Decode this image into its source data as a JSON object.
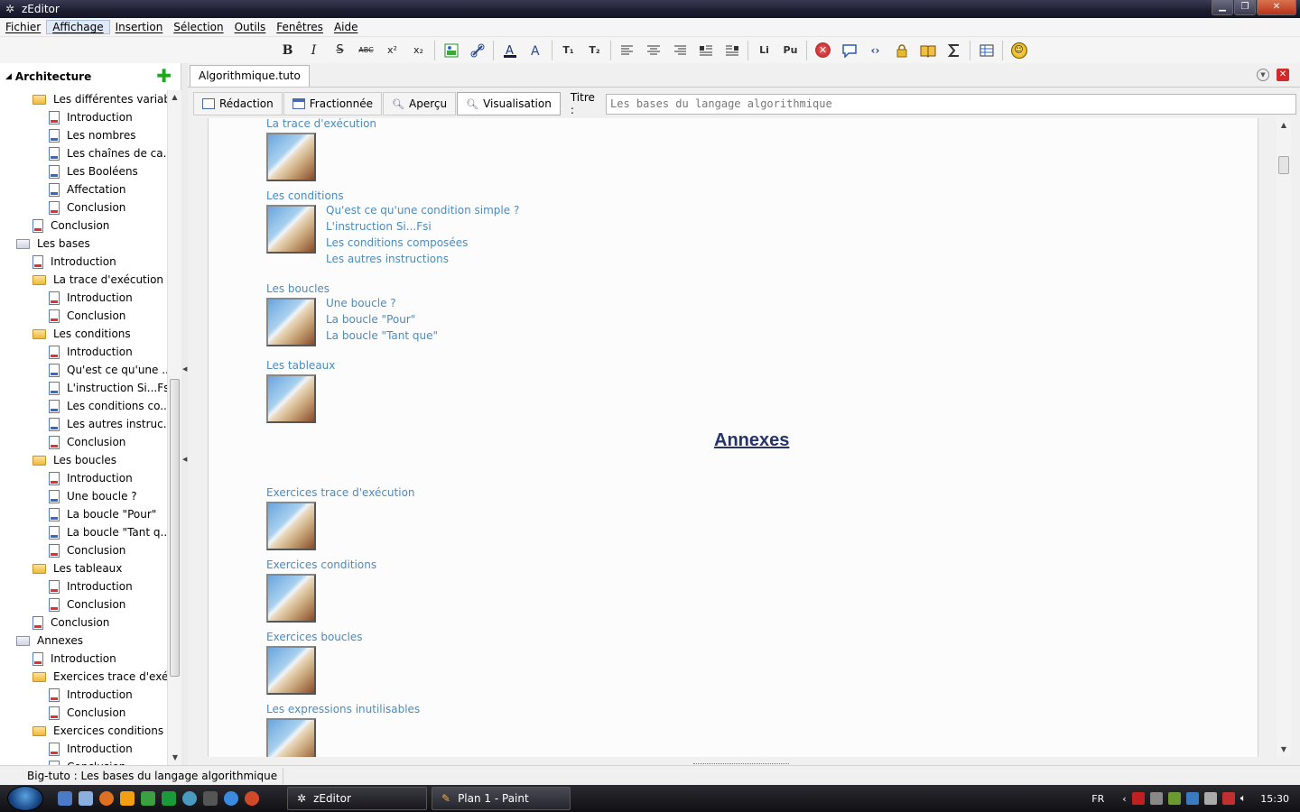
{
  "window": {
    "title": "zEditor"
  },
  "menu": [
    "Fichier",
    "Affichage",
    "Insertion",
    "Sélection",
    "Outils",
    "Fenêtres",
    "Aide"
  ],
  "toolbar": {
    "bold": "B",
    "italic": "I",
    "strike": "S",
    "caps": "ABC",
    "sup": "x²",
    "sub": "x₂",
    "li": "Li",
    "pu": "Pu",
    "t1": "T₁",
    "t2": "T₂"
  },
  "sidebar": {
    "header": "Architecture",
    "items": [
      {
        "label": "Les différentes variab...",
        "icon": "folder",
        "level": 1
      },
      {
        "label": "Introduction",
        "icon": "doc-red",
        "level": 2
      },
      {
        "label": "Les nombres",
        "icon": "doc",
        "level": 2
      },
      {
        "label": "Les chaînes de ca...",
        "icon": "doc",
        "level": 2
      },
      {
        "label": "Les Booléens",
        "icon": "doc",
        "level": 2
      },
      {
        "label": "Affectation",
        "icon": "doc",
        "level": 2
      },
      {
        "label": "Conclusion",
        "icon": "doc-red",
        "level": 2
      },
      {
        "label": "Conclusion",
        "icon": "doc-red",
        "level": 1
      },
      {
        "label": "Les bases",
        "icon": "folder-root",
        "level": 0
      },
      {
        "label": "Introduction",
        "icon": "doc-red",
        "level": 1
      },
      {
        "label": "La trace d'exécution",
        "icon": "folder",
        "level": 1
      },
      {
        "label": "Introduction",
        "icon": "doc-red",
        "level": 2
      },
      {
        "label": "Conclusion",
        "icon": "doc-red",
        "level": 2
      },
      {
        "label": "Les conditions",
        "icon": "folder",
        "level": 1
      },
      {
        "label": "Introduction",
        "icon": "doc-red",
        "level": 2
      },
      {
        "label": "Qu'est ce qu'une ...",
        "icon": "doc",
        "level": 2
      },
      {
        "label": "L'instruction Si...Fsi",
        "icon": "doc",
        "level": 2
      },
      {
        "label": "Les conditions co...",
        "icon": "doc",
        "level": 2
      },
      {
        "label": "Les autres instruc...",
        "icon": "doc",
        "level": 2
      },
      {
        "label": "Conclusion",
        "icon": "doc-red",
        "level": 2
      },
      {
        "label": "Les boucles",
        "icon": "folder",
        "level": 1
      },
      {
        "label": "Introduction",
        "icon": "doc-red",
        "level": 2
      },
      {
        "label": "Une boucle ?",
        "icon": "doc",
        "level": 2
      },
      {
        "label": "La boucle \"Pour\"",
        "icon": "doc",
        "level": 2
      },
      {
        "label": "La boucle \"Tant q...",
        "icon": "doc",
        "level": 2
      },
      {
        "label": "Conclusion",
        "icon": "doc-red",
        "level": 2
      },
      {
        "label": "Les tableaux",
        "icon": "folder",
        "level": 1
      },
      {
        "label": "Introduction",
        "icon": "doc-red",
        "level": 2
      },
      {
        "label": "Conclusion",
        "icon": "doc-red",
        "level": 2
      },
      {
        "label": "Conclusion",
        "icon": "doc-red",
        "level": 1
      },
      {
        "label": "Annexes",
        "icon": "folder-root",
        "level": 0
      },
      {
        "label": "Introduction",
        "icon": "doc-red",
        "level": 1
      },
      {
        "label": "Exercices trace d'exéc...",
        "icon": "folder",
        "level": 1
      },
      {
        "label": "Introduction",
        "icon": "doc-red",
        "level": 2
      },
      {
        "label": "Conclusion",
        "icon": "doc-red",
        "level": 2
      },
      {
        "label": "Exercices conditions",
        "icon": "folder",
        "level": 1
      },
      {
        "label": "Introduction",
        "icon": "doc-red",
        "level": 2
      },
      {
        "label": "Conclusion",
        "icon": "doc-red",
        "level": 2
      }
    ]
  },
  "doc": {
    "tab": "Algorithmique.tuto",
    "modes": [
      "Rédaction",
      "Fractionnée",
      "Aperçu",
      "Visualisation"
    ],
    "active_mode": "Visualisation",
    "title_label": "Titre :",
    "title_value": "Les bases du langage algorithmique"
  },
  "viewer": {
    "sections": [
      {
        "title": "La trace d'exécution",
        "subs": []
      },
      {
        "title": "Les conditions",
        "subs": [
          "Qu'est ce qu'une condition simple ?",
          "L'instruction Si...Fsi",
          "Les conditions composées",
          "Les autres instructions"
        ]
      },
      {
        "title": "Les boucles",
        "subs": [
          "Une boucle ?",
          "La boucle \"Pour\"",
          "La boucle \"Tant que\""
        ]
      },
      {
        "title": "Les tableaux",
        "subs": []
      }
    ],
    "annexes_heading": "Annexes",
    "annex_sections": [
      "Exercices trace d'exécution",
      "Exercices conditions",
      "Exercices boucles",
      "Les expressions inutilisables"
    ]
  },
  "status": "Big-tuto : Les bases du langage algorithmique",
  "taskbar": {
    "tasks": [
      "zEditor",
      "Plan 1 - Paint"
    ],
    "lang": "FR",
    "clock": "15:30"
  }
}
